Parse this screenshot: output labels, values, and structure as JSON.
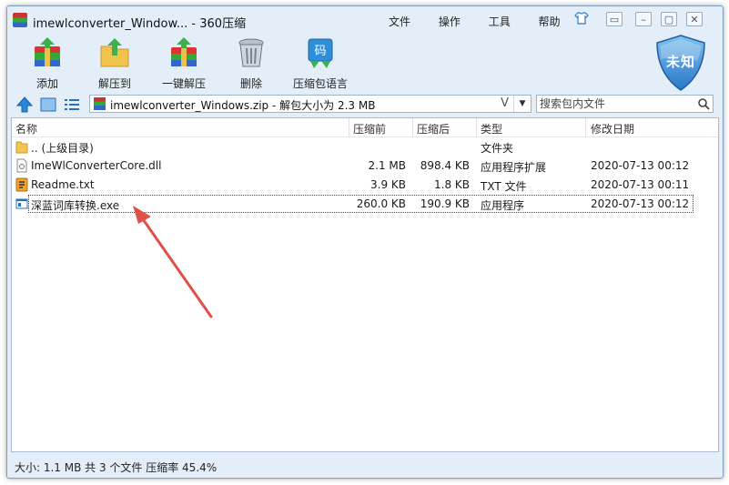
{
  "window": {
    "title": "imewlconverter_Window... - 360压缩",
    "menu": [
      "文件",
      "操作",
      "工具",
      "帮助"
    ]
  },
  "toolbar": {
    "buttons": [
      {
        "label": "添加",
        "icon": "add-archive-icon"
      },
      {
        "label": "解压到",
        "icon": "extract-to-icon"
      },
      {
        "label": "一键解压",
        "icon": "one-click-extract-icon"
      },
      {
        "label": "删除",
        "icon": "trash-icon"
      },
      {
        "label": "压缩包语言",
        "icon": "archive-language-icon"
      }
    ],
    "security_badge": "未知"
  },
  "address": {
    "path": "imewlconverter_Windows.zip - 解包大小为 2.3 MB",
    "v_marker": "V",
    "search_placeholder": "搜索包内文件"
  },
  "columns": [
    "名称",
    "压缩前",
    "压缩后",
    "类型",
    "修改日期"
  ],
  "rows": [
    {
      "name": ".. (上级目录)",
      "size": "",
      "packed": "",
      "type": "文件夹",
      "date": "",
      "icon": "folder-icon"
    },
    {
      "name": "ImeWlConverterCore.dll",
      "size": "2.1 MB",
      "packed": "898.4 KB",
      "type": "应用程序扩展",
      "date": "2020-07-13 00:12",
      "icon": "dll-file-icon"
    },
    {
      "name": "Readme.txt",
      "size": "3.9 KB",
      "packed": "1.8 KB",
      "type": "TXT 文件",
      "date": "2020-07-13 00:11",
      "icon": "text-file-icon"
    },
    {
      "name": "深蓝词库转换.exe",
      "size": "260.0 KB",
      "packed": "190.9 KB",
      "type": "应用程序",
      "date": "2020-07-13 00:12",
      "icon": "exe-file-icon"
    }
  ],
  "status": "大小: 1.1 MB 共 3 个文件 压缩率 45.4%",
  "colors": {
    "accent": "#2a78c8",
    "window_bg": "#e3eef9",
    "arrow": "#e0504a"
  }
}
